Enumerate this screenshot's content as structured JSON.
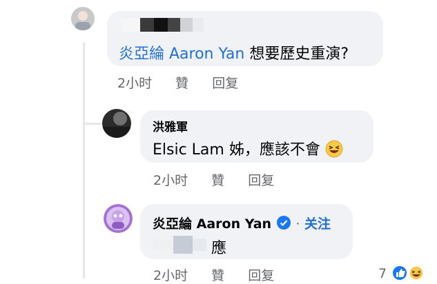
{
  "comment1": {
    "name_blurred": "",
    "mention": "炎亞綸 Aaron Yan",
    "text": " 想要歷史重演?",
    "time": "2小时",
    "like": "贊",
    "reply": "回复"
  },
  "comment2": {
    "name": "洪雅軍",
    "text": "Elsic Lam 姊，應該不會",
    "emoji": "grinning-squinting-face-icon",
    "time": "2小时",
    "like": "贊",
    "reply": "回复"
  },
  "comment3": {
    "name": "炎亞綸 Aaron Yan",
    "verified": "verified-badge-icon",
    "follow": "关注",
    "text_prefix_blurred": "洪",
    "text": "應",
    "time": "2小时",
    "like": "贊",
    "reply": "回复",
    "reaction_count": "7"
  },
  "colors": {
    "bubble": "#f0f2f5",
    "mention": "#216fdb",
    "meta": "#65676b",
    "verified": "#1877f2"
  }
}
